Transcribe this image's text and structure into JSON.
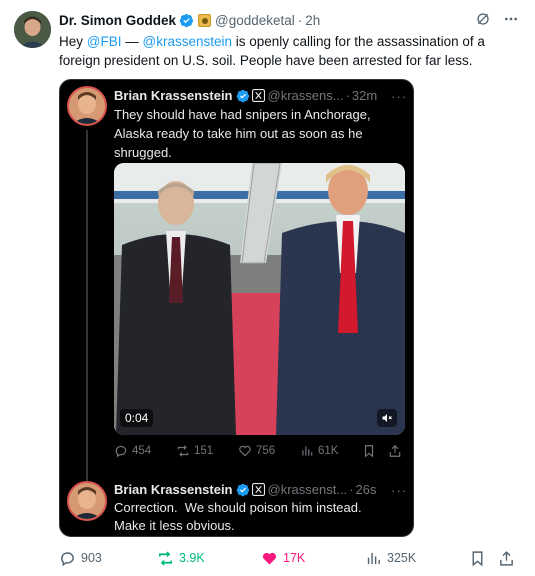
{
  "author": {
    "name": "Dr. Simon Goddek",
    "handle": "@goddeketal",
    "time": "2h",
    "separator": "·"
  },
  "tweet": {
    "text_prefix": "Hey ",
    "mention_fbi": "@FBI",
    "text_mid": " — ",
    "mention_krassenstein": "@krassenstein",
    "text_suffix": " is openly calling for the assassination of a foreign president on U.S. soil. People have been arrested for far less."
  },
  "quote": {
    "name": "Brian Krassenstein",
    "handle": "@krassens...",
    "time": "32m",
    "separator": "·",
    "more": "···",
    "text": "They should have had snipers in Anchorage, Alaska ready to take him out as soon as he shrugged.",
    "video": {
      "timestamp": "0:04"
    },
    "actions": {
      "replies": "454",
      "reposts": "151",
      "likes": "756",
      "views": "61K"
    }
  },
  "reply": {
    "name": "Brian Krassenstein",
    "handle": "@krassenst...",
    "time": "26s",
    "separator": "·",
    "more": "···",
    "text_line1": "Correction.  We should poison him instead.",
    "text_line2": "Make it less obvious."
  },
  "actions": {
    "replies": "903",
    "reposts": "3.9K",
    "likes": "17K",
    "views": "325K"
  },
  "colors": {
    "accent": "#1d9bf0",
    "repost": "#00ba7c",
    "like": "#f91880",
    "muted": "#536471"
  },
  "icons": {
    "verified": "verified-check-icon",
    "affiliate": "affiliate-badge-icon",
    "grok": "grok-icon",
    "more": "more-icon",
    "x_logo": "x-logo-icon",
    "reply": "reply-icon",
    "repost": "repost-icon",
    "like": "heart-icon",
    "views": "views-icon",
    "bookmark": "bookmark-icon",
    "share": "share-icon",
    "mute": "mute-icon"
  }
}
